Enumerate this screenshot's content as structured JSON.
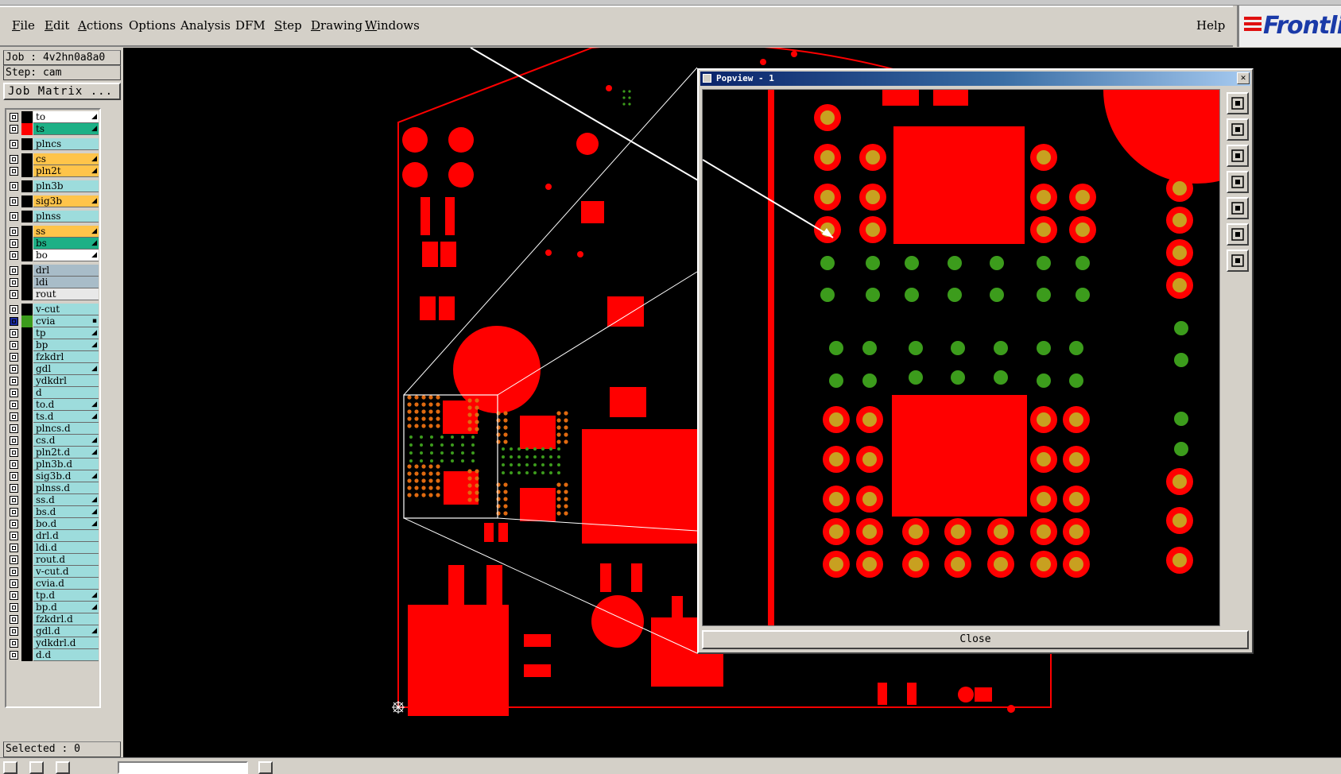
{
  "menu": {
    "items": [
      {
        "label": "File",
        "underline": "F"
      },
      {
        "label": "Edit",
        "underline": "E"
      },
      {
        "label": "Actions",
        "underline": "A"
      },
      {
        "label": "Options",
        "underline": ""
      },
      {
        "label": "Analysis",
        "underline": ""
      },
      {
        "label": "DFM",
        "underline": ""
      },
      {
        "label": "Step",
        "underline": "S"
      },
      {
        "label": "Drawing",
        "underline": "D"
      },
      {
        "label": "Windows",
        "underline": "W"
      }
    ],
    "help": "Help"
  },
  "logo": {
    "text": "Frontli"
  },
  "job": {
    "job_label": "Job : 4v2hn0a8a0",
    "step_label": "Step: cam"
  },
  "job_matrix_label": "Job Matrix ...",
  "selected_label": "Selected : 0",
  "colors": {
    "pad_red": "#ff0000",
    "via_green": "#3c9c1c",
    "drill_gold": "#c8a020",
    "orange_dots": "#e06a10",
    "cyan_layer": "#9ddcdc",
    "orange_layer": "#ffc44a",
    "teal_layer": "#1db086",
    "gray_layer": "#a8bcc8",
    "white_layer": "#ffffff"
  },
  "layers": [
    {
      "name": "to",
      "color": "#000000",
      "bg": "#ffffff",
      "checked": false,
      "flag": "◢"
    },
    {
      "name": "ts",
      "color": "#ff0000",
      "bg": "#1db086",
      "checked": false,
      "flag": "◢"
    },
    {
      "name": "plncs",
      "color": "#000000",
      "bg": "#9ddcdc",
      "checked": false,
      "flag": ""
    },
    {
      "name": "cs",
      "color": "#000000",
      "bg": "#ffc44a",
      "checked": false,
      "flag": "◢"
    },
    {
      "name": "pln2t",
      "color": "#000000",
      "bg": "#ffc44a",
      "checked": false,
      "flag": "◢"
    },
    {
      "name": "pln3b",
      "color": "#000000",
      "bg": "#9ddcdc",
      "checked": false,
      "flag": ""
    },
    {
      "name": "sig3b",
      "color": "#000000",
      "bg": "#ffc44a",
      "checked": false,
      "flag": "◢"
    },
    {
      "name": "plnss",
      "color": "#000000",
      "bg": "#9ddcdc",
      "checked": false,
      "flag": ""
    },
    {
      "name": "ss",
      "color": "#000000",
      "bg": "#ffc44a",
      "checked": false,
      "flag": "◢"
    },
    {
      "name": "bs",
      "color": "#000000",
      "bg": "#1db086",
      "checked": false,
      "flag": "◢"
    },
    {
      "name": "bo",
      "color": "#000000",
      "bg": "#ffffff",
      "checked": false,
      "flag": "◢"
    },
    {
      "name": "drl",
      "color": "#000000",
      "bg": "#a8bcc8",
      "checked": false,
      "flag": ""
    },
    {
      "name": "ldi",
      "color": "#000000",
      "bg": "#a8bcc8",
      "checked": false,
      "flag": ""
    },
    {
      "name": "rout",
      "color": "#000000",
      "bg": "#e8e8e8",
      "checked": false,
      "flag": ""
    },
    {
      "name": "v-cut",
      "color": "#000000",
      "bg": "#9ddcdc",
      "checked": false,
      "flag": ""
    },
    {
      "name": "cvia",
      "color": "#3c9c1c",
      "bg": "#9ddcdc",
      "checked": true,
      "flag": "▪"
    },
    {
      "name": "tp",
      "color": "#000000",
      "bg": "#9ddcdc",
      "checked": false,
      "flag": "◢"
    },
    {
      "name": "bp",
      "color": "#000000",
      "bg": "#9ddcdc",
      "checked": false,
      "flag": "◢"
    },
    {
      "name": "fzkdrl",
      "color": "#000000",
      "bg": "#9ddcdc",
      "checked": false,
      "flag": ""
    },
    {
      "name": "gdl",
      "color": "#000000",
      "bg": "#9ddcdc",
      "checked": false,
      "flag": "◢"
    },
    {
      "name": "ydkdrl",
      "color": "#000000",
      "bg": "#9ddcdc",
      "checked": false,
      "flag": ""
    },
    {
      "name": "d",
      "color": "#000000",
      "bg": "#9ddcdc",
      "checked": false,
      "flag": ""
    },
    {
      "name": "to.d",
      "color": "#000000",
      "bg": "#9ddcdc",
      "checked": false,
      "flag": "◢"
    },
    {
      "name": "ts.d",
      "color": "#000000",
      "bg": "#9ddcdc",
      "checked": false,
      "flag": "◢"
    },
    {
      "name": "plncs.d",
      "color": "#000000",
      "bg": "#9ddcdc",
      "checked": false,
      "flag": ""
    },
    {
      "name": "cs.d",
      "color": "#000000",
      "bg": "#9ddcdc",
      "checked": false,
      "flag": "◢"
    },
    {
      "name": "pln2t.d",
      "color": "#000000",
      "bg": "#9ddcdc",
      "checked": false,
      "flag": "◢"
    },
    {
      "name": "pln3b.d",
      "color": "#000000",
      "bg": "#9ddcdc",
      "checked": false,
      "flag": ""
    },
    {
      "name": "sig3b.d",
      "color": "#000000",
      "bg": "#9ddcdc",
      "checked": false,
      "flag": "◢"
    },
    {
      "name": "plnss.d",
      "color": "#000000",
      "bg": "#9ddcdc",
      "checked": false,
      "flag": ""
    },
    {
      "name": "ss.d",
      "color": "#000000",
      "bg": "#9ddcdc",
      "checked": false,
      "flag": "◢"
    },
    {
      "name": "bs.d",
      "color": "#000000",
      "bg": "#9ddcdc",
      "checked": false,
      "flag": "◢"
    },
    {
      "name": "bo.d",
      "color": "#000000",
      "bg": "#9ddcdc",
      "checked": false,
      "flag": "◢"
    },
    {
      "name": "drl.d",
      "color": "#000000",
      "bg": "#9ddcdc",
      "checked": false,
      "flag": ""
    },
    {
      "name": "ldi.d",
      "color": "#000000",
      "bg": "#9ddcdc",
      "checked": false,
      "flag": ""
    },
    {
      "name": "rout.d",
      "color": "#000000",
      "bg": "#9ddcdc",
      "checked": false,
      "flag": ""
    },
    {
      "name": "v-cut.d",
      "color": "#000000",
      "bg": "#9ddcdc",
      "checked": false,
      "flag": ""
    },
    {
      "name": "cvia.d",
      "color": "#000000",
      "bg": "#9ddcdc",
      "checked": false,
      "flag": ""
    },
    {
      "name": "tp.d",
      "color": "#000000",
      "bg": "#9ddcdc",
      "checked": false,
      "flag": "◢"
    },
    {
      "name": "bp.d",
      "color": "#000000",
      "bg": "#9ddcdc",
      "checked": false,
      "flag": "◢"
    },
    {
      "name": "fzkdrl.d",
      "color": "#000000",
      "bg": "#9ddcdc",
      "checked": false,
      "flag": ""
    },
    {
      "name": "gdl.d",
      "color": "#000000",
      "bg": "#9ddcdc",
      "checked": false,
      "flag": "◢"
    },
    {
      "name": "ydkdrl.d",
      "color": "#000000",
      "bg": "#9ddcdc",
      "checked": false,
      "flag": ""
    },
    {
      "name": "d.d",
      "color": "#000000",
      "bg": "#9ddcdc",
      "checked": false,
      "flag": ""
    }
  ],
  "popview": {
    "title": "Popview - 1",
    "close_x": "✕",
    "close_button": "Close",
    "tools": [
      "zoom-window-icon",
      "pan-up-icon",
      "pan-down-icon",
      "pan-left-icon",
      "pan-right-icon",
      "zoom-in-icon",
      "zoom-out-icon"
    ]
  }
}
